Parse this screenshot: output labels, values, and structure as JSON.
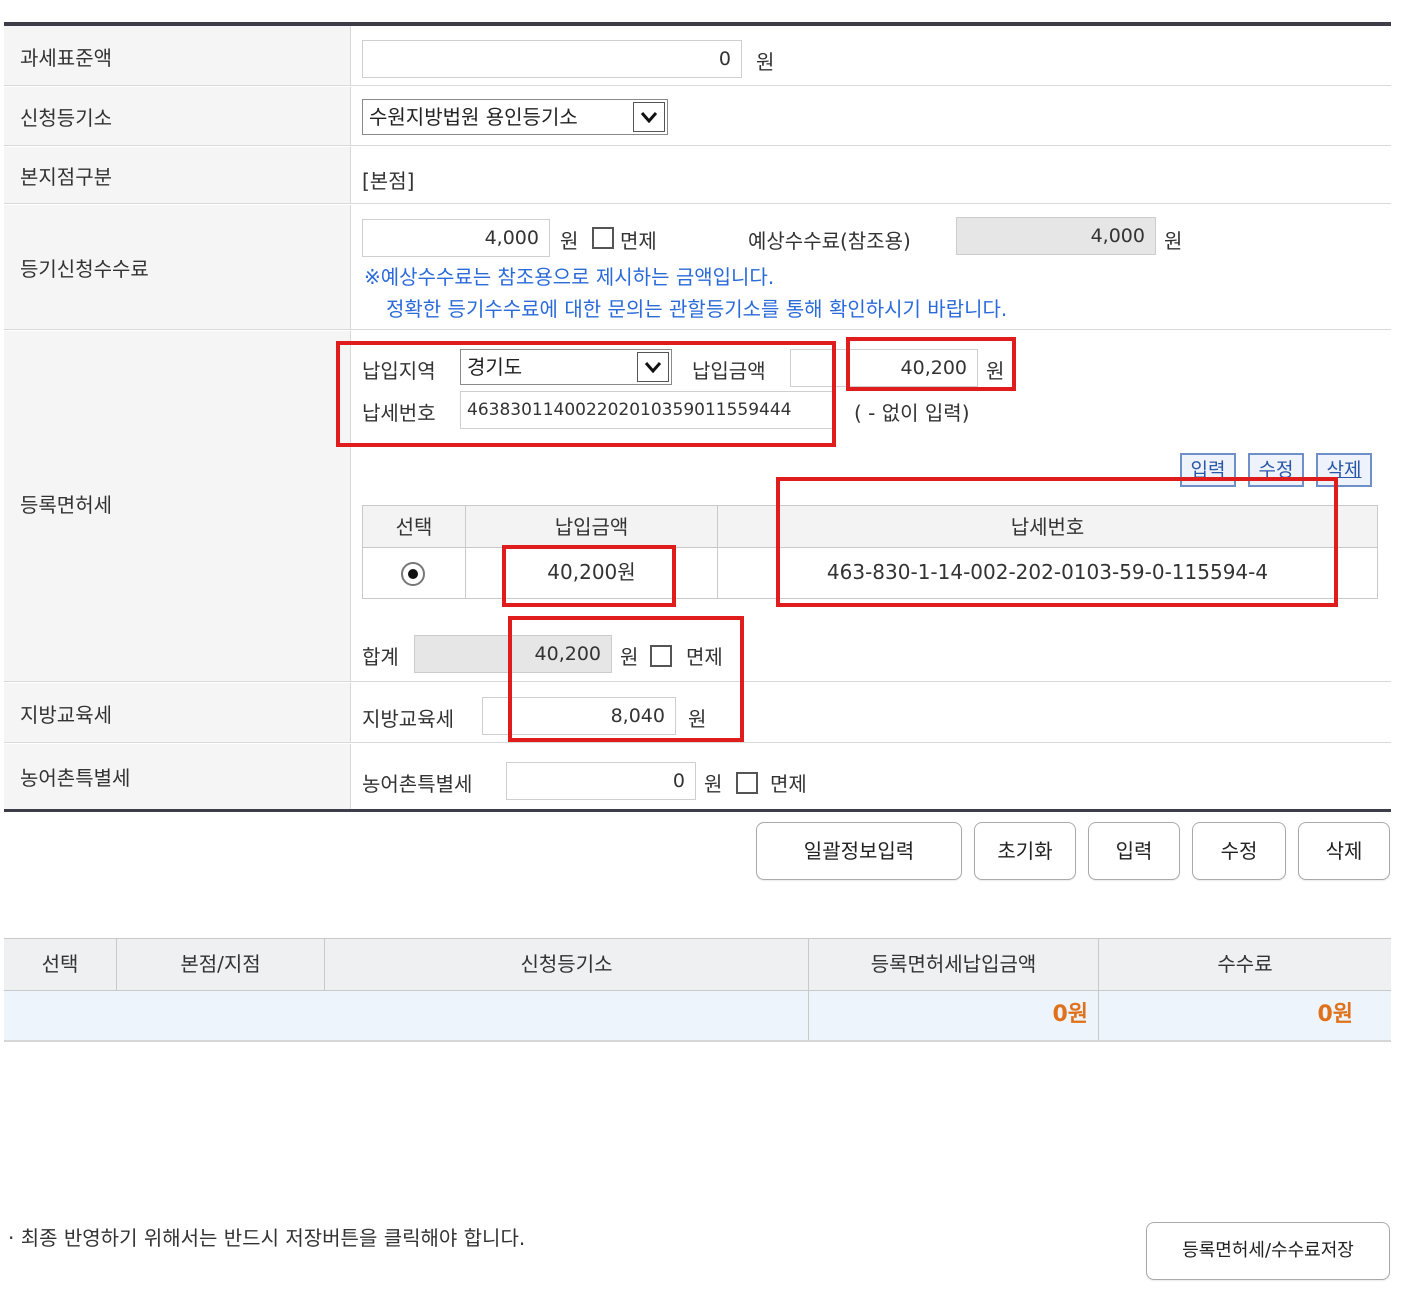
{
  "form": {
    "tax_base": {
      "label": "과세표준액",
      "value": "0",
      "unit": "원"
    },
    "registry_office": {
      "label": "신청등기소",
      "selected": "수원지방법원 용인등기소"
    },
    "branch_type": {
      "label": "본지점구분",
      "value": "[본점]"
    },
    "registration_fee": {
      "label": "등기신청수수료",
      "value": "4,000",
      "unit": "원",
      "exempt_label": "면제",
      "expected_label": "예상수수료(참조용)",
      "expected_value": "4,000",
      "expected_unit": "원",
      "notice_line1": "※예상수수료는 참조용으로 제시하는 금액입니다.",
      "notice_line2": "정확한 등기수수료에 대한 문의는 관할등기소를 통해 확인하시기 바랍니다."
    },
    "license_tax": {
      "label": "등록면허세",
      "region_label": "납입지역",
      "region_selected": "경기도",
      "amount_label": "납입금액",
      "amount_value": "40,200",
      "amount_unit": "원",
      "taxno_label": "납세번호",
      "taxno_value": "463830114002202010359011559444",
      "taxno_hint": "( - 없이 입력)",
      "actions": {
        "add": "입력",
        "edit": "수정",
        "delete": "삭제"
      },
      "table": {
        "headers": [
          "선택",
          "납입금액",
          "납세번호"
        ],
        "rows": [
          {
            "amount": "40,200원",
            "taxno": "463-830-1-14-002-202-0103-59-0-115594-4"
          }
        ]
      },
      "total_label": "합계",
      "total_value": "40,200",
      "total_unit": "원",
      "total_exempt_label": "면제"
    },
    "local_edu_tax": {
      "label": "지방교육세",
      "inner_label": "지방교육세",
      "value": "8,040",
      "unit": "원"
    },
    "rural_tax": {
      "label": "농어촌특별세",
      "inner_label": "농어촌특별세",
      "value": "0",
      "unit": "원",
      "exempt_label": "면제"
    }
  },
  "buttons": {
    "bulk_input": "일괄정보입력",
    "reset": "초기화",
    "input": "입력",
    "edit": "수정",
    "delete": "삭제",
    "save": "등록면허세/수수료저장"
  },
  "summary": {
    "headers": [
      "선택",
      "본점/지점",
      "신청등기소",
      "등록면허세납입금액",
      "수수료"
    ],
    "license_total": "0원",
    "fee_total": "0원"
  },
  "notice": "· 최종 반영하기 위해서는 반드시 저장버튼을 클릭해야 합니다.",
  "colors": {
    "accent_red": "#e01d1d",
    "link_blue": "#2a6ad9",
    "orange": "#e0711b"
  }
}
